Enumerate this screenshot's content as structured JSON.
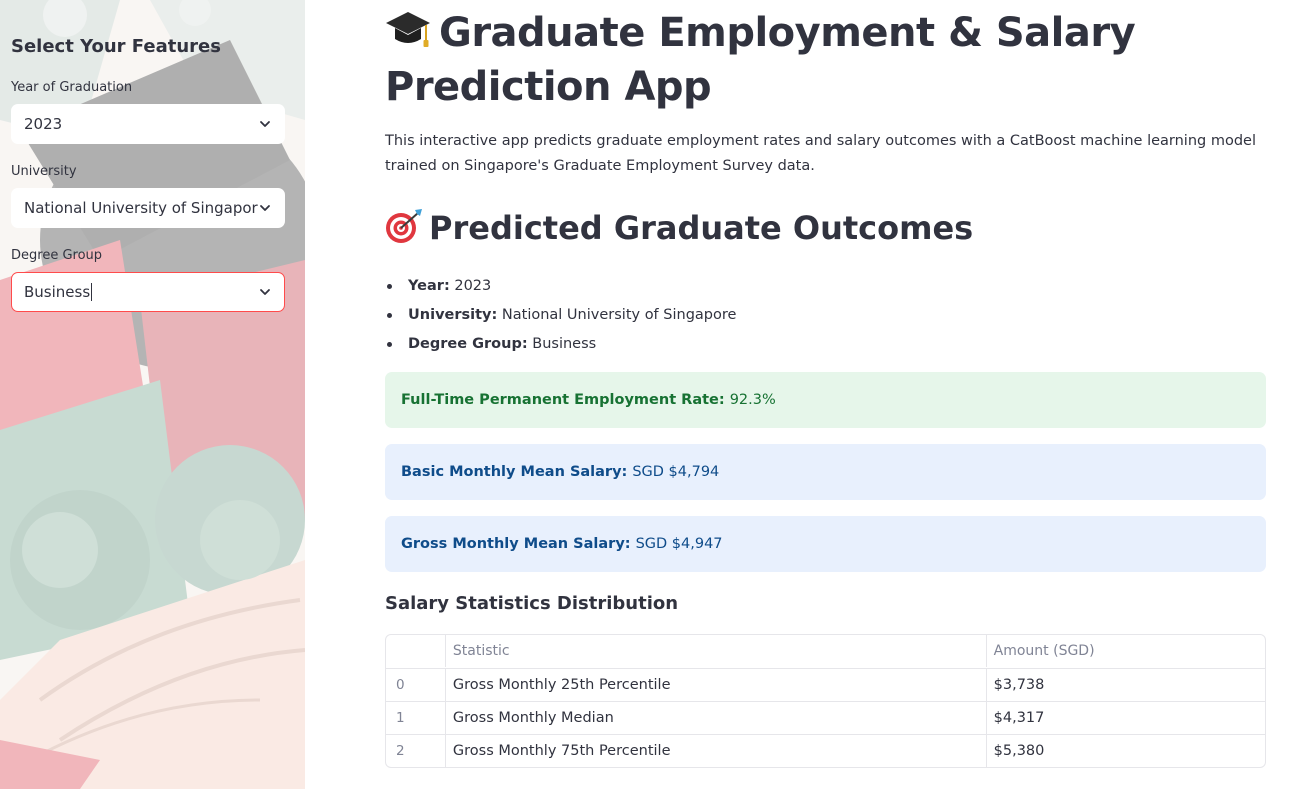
{
  "sidebar": {
    "header": "Select Your Features",
    "fields": [
      {
        "label": "Year of Graduation",
        "value": "2023",
        "icon": "chevron-down-icon"
      },
      {
        "label": "University",
        "value": "National University of Singapore",
        "icon": "chevron-down-icon"
      },
      {
        "label": "Degree Group",
        "value": "Business",
        "icon": "chevron-down-icon",
        "focused": true
      }
    ]
  },
  "main": {
    "title_icon": "graduation-cap-icon",
    "title": "Graduate Employment & Salary Prediction App",
    "intro": "This interactive app predicts graduate employment rates and salary outcomes with a CatBoost machine learning model trained on Singapore's Graduate Employment Survey data.",
    "outcomes_icon": "target-icon",
    "outcomes_title": "Predicted Graduate Outcomes",
    "summary": [
      {
        "label": "Year:",
        "value": "2023"
      },
      {
        "label": "University:",
        "value": "National University of Singapore"
      },
      {
        "label": "Degree Group:",
        "value": "Business"
      }
    ],
    "alerts": [
      {
        "label": "Full-Time Permanent Employment Rate:",
        "value": "92.3%"
      },
      {
        "label": "Basic Monthly Mean Salary:",
        "value": "SGD $4,794"
      },
      {
        "label": "Gross Monthly Mean Salary:",
        "value": "SGD $4,947"
      }
    ],
    "table_title": "Salary Statistics Distribution",
    "table": {
      "columns": [
        "",
        "Statistic",
        "Amount (SGD)"
      ],
      "rows": [
        [
          "0",
          "Gross Monthly 25th Percentile",
          "$3,738"
        ],
        [
          "1",
          "Gross Monthly Median",
          "$4,317"
        ],
        [
          "2",
          "Gross Monthly 75th Percentile",
          "$5,380"
        ]
      ]
    }
  },
  "colors": {
    "focus_border": "#ff4b4b",
    "success_bg": "#e6f6ea",
    "success_text": "#177233",
    "info_bg": "#e8f0fd",
    "info_text": "#0f4c8a"
  }
}
